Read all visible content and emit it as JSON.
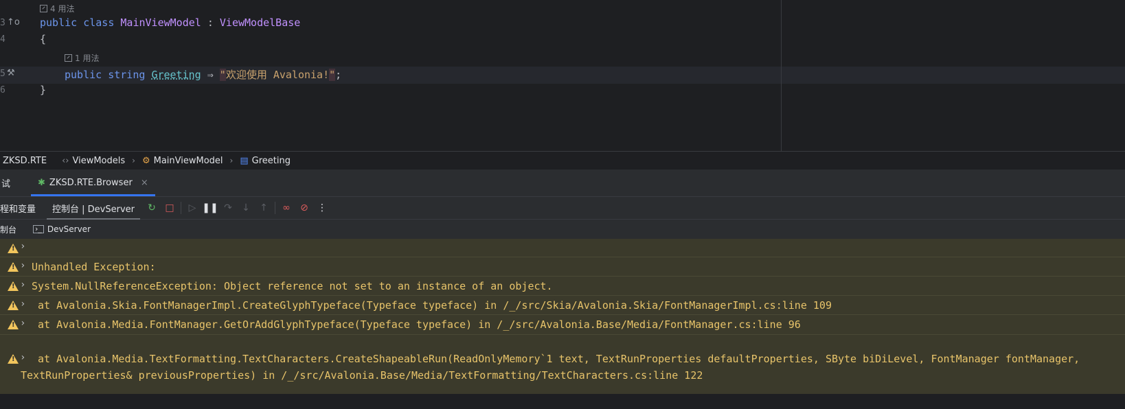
{
  "editor": {
    "hint_top": "4 用法",
    "hint_mid": "1 用法",
    "gutter": [
      "3",
      "4",
      "5",
      "6"
    ],
    "line3": {
      "kw1": "public",
      "kw2": "class",
      "cls": "MainViewModel",
      "colon": " : ",
      "base": "ViewModelBase"
    },
    "line4": "{",
    "line5": {
      "kw1": "public",
      "kw2": "string",
      "prop": "Greeting",
      "arrow": "⇒",
      "q1": "\"",
      "text": "欢迎使用 Avalonia!",
      "q2": "\"",
      "semi": ";"
    },
    "line6": "}"
  },
  "breadcrumb": {
    "project": "ZKSD.RTE",
    "ns": "ViewModels",
    "class": "MainViewModel",
    "member": "Greeting"
  },
  "toolwindow": {
    "left_label": "试",
    "run_tab": "ZKSD.RTE.Browser",
    "tab_threads": "程和变量",
    "tab_console": "控制台 | DevServer",
    "sub_console": "制台",
    "sub_devserver": "DevServer"
  },
  "console": {
    "rows": [
      "",
      "Unhandled Exception:",
      "System.NullReferenceException: Object reference not set to an instance of an object.",
      " at Avalonia.Skia.FontManagerImpl.CreateGlyphTypeface(Typeface typeface) in /_/src/Skia/Avalonia.Skia/FontManagerImpl.cs:line 109",
      " at Avalonia.Media.FontManager.GetOrAddGlyphTypeface(Typeface typeface) in /_/src/Avalonia.Base/Media/FontManager.cs:line 96",
      " at Avalonia.Media.TextFormatting.TextCharacters.CreateShapeableRun(ReadOnlyMemory`1 text, TextRunProperties defaultProperties, SByte biDiLevel, FontManager fontManager,",
      "TextRunProperties& previousProperties) in /_/src/Avalonia.Base/Media/TextFormatting/TextCharacters.cs:line 122"
    ]
  },
  "colors": {
    "accent": "#3574f0",
    "warning": "#f2c55c",
    "console_bg": "#3b3a2b"
  }
}
